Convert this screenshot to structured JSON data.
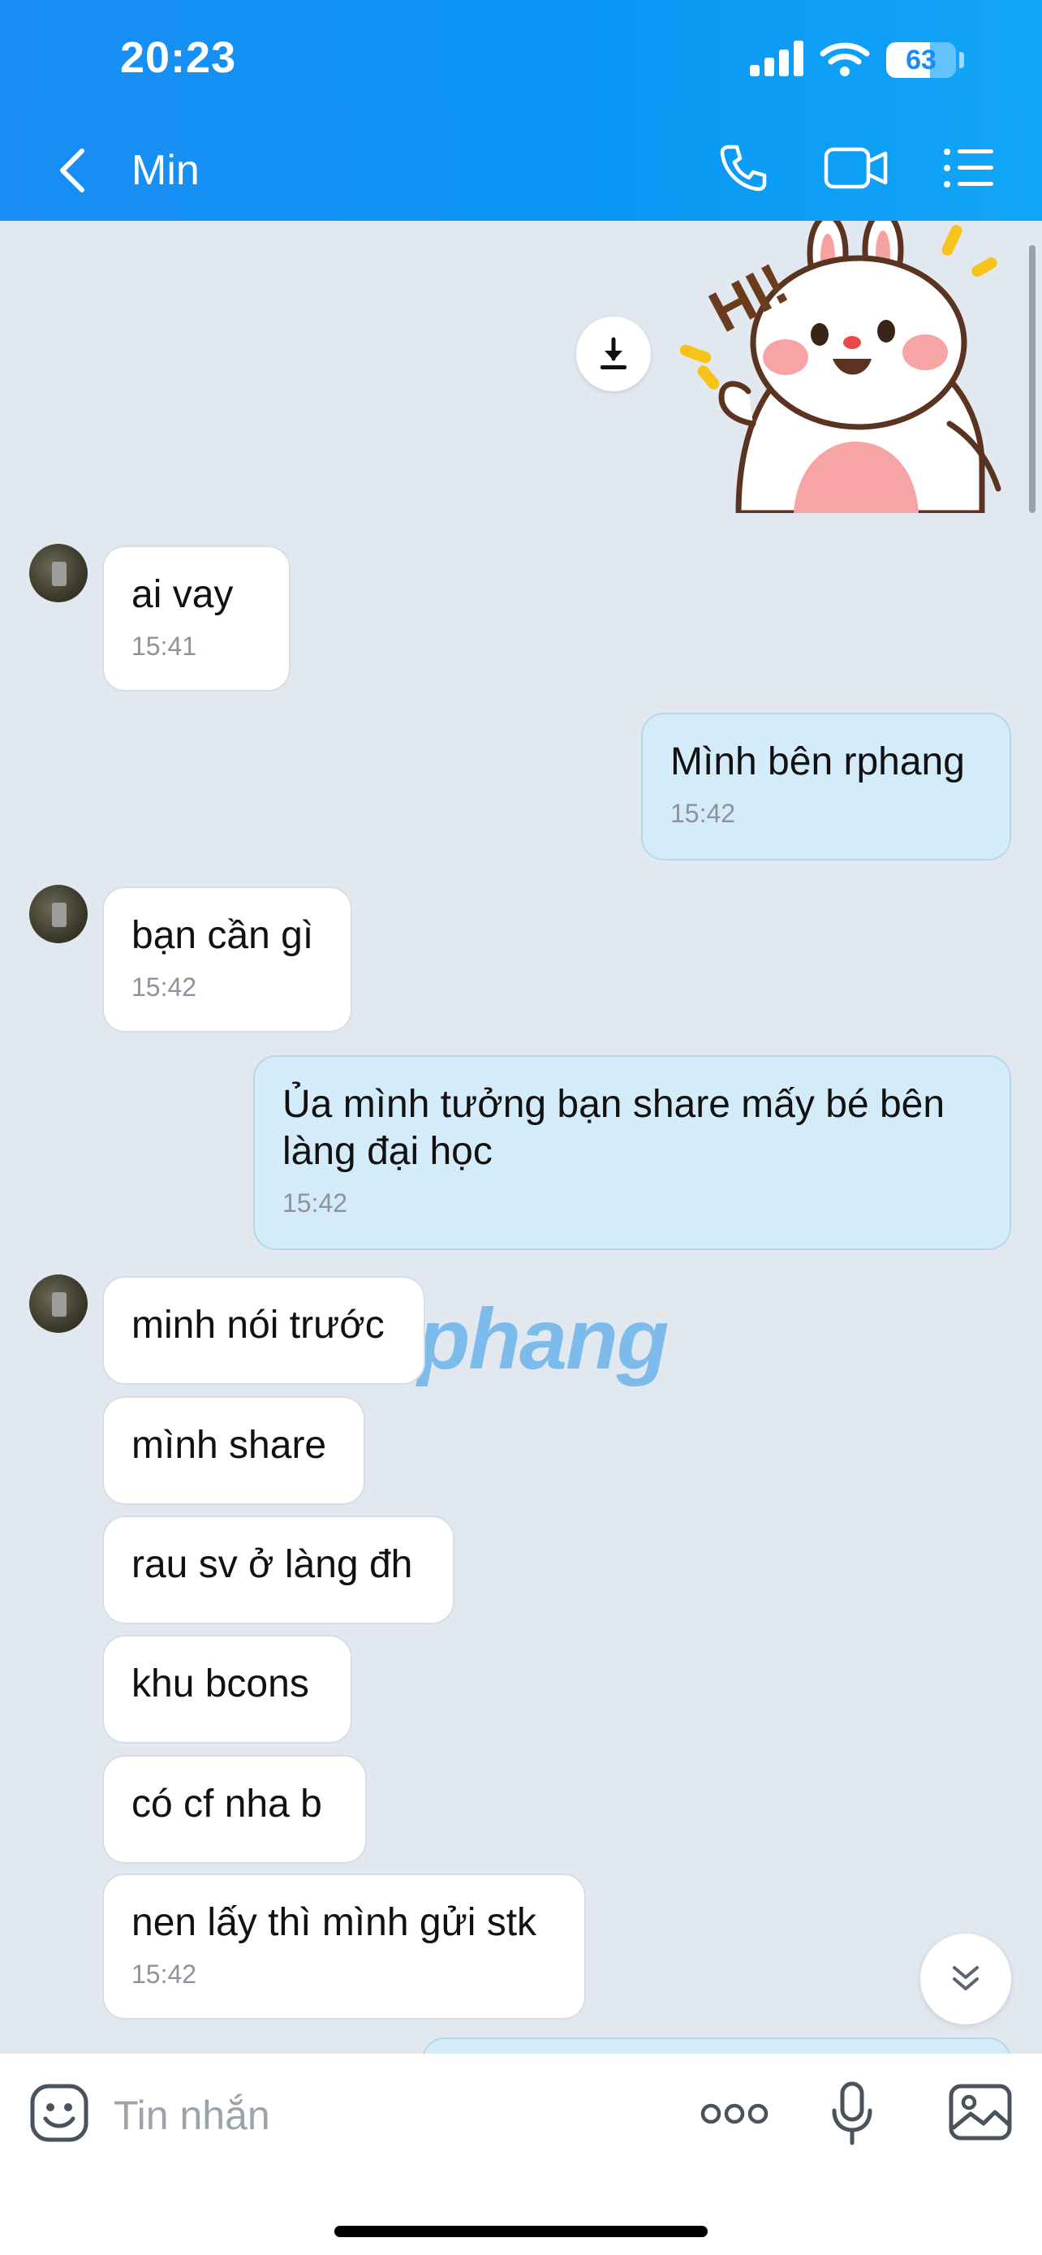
{
  "status_bar": {
    "time": "20:23",
    "battery_level": 63,
    "battery_text": "63"
  },
  "header": {
    "contact_name": "Min",
    "icons": [
      "back-icon",
      "phone-icon",
      "video-camera-icon",
      "list-icon"
    ]
  },
  "messages": [
    {
      "side": "in",
      "text": "ai vay",
      "time": "15:41"
    },
    {
      "side": "out",
      "text": "Mình bên rphang",
      "time": "15:42"
    },
    {
      "side": "in",
      "text": "bạn cần gì",
      "time": "15:42"
    },
    {
      "side": "out",
      "text": "Ủa mình tưởng bạn share mấy bé bên làng đại học",
      "time": "15:42"
    },
    {
      "side": "in",
      "text": "minh nói trước"
    },
    {
      "side": "in",
      "text": "mình share"
    },
    {
      "side": "in",
      "text": "rau sv ở làng đh"
    },
    {
      "side": "in",
      "text": "khu bcons"
    },
    {
      "side": "in",
      "text": "có cf nha b"
    },
    {
      "side": "in",
      "text": "nen lấy thì mình gửi stk",
      "time": "15:42"
    }
  ],
  "sticker": {
    "text": "HI!"
  },
  "watermark": "Rphang",
  "composer": {
    "placeholder": "Tin nhắn",
    "icons": [
      "emoji-icon",
      "more-icon",
      "microphone-icon",
      "image-icon"
    ]
  },
  "colors": {
    "header": "#0a97f4",
    "chat_bg": "#e2e8f0",
    "bubble_out": "#d4ecfa",
    "bubble_in": "#ffffff"
  }
}
